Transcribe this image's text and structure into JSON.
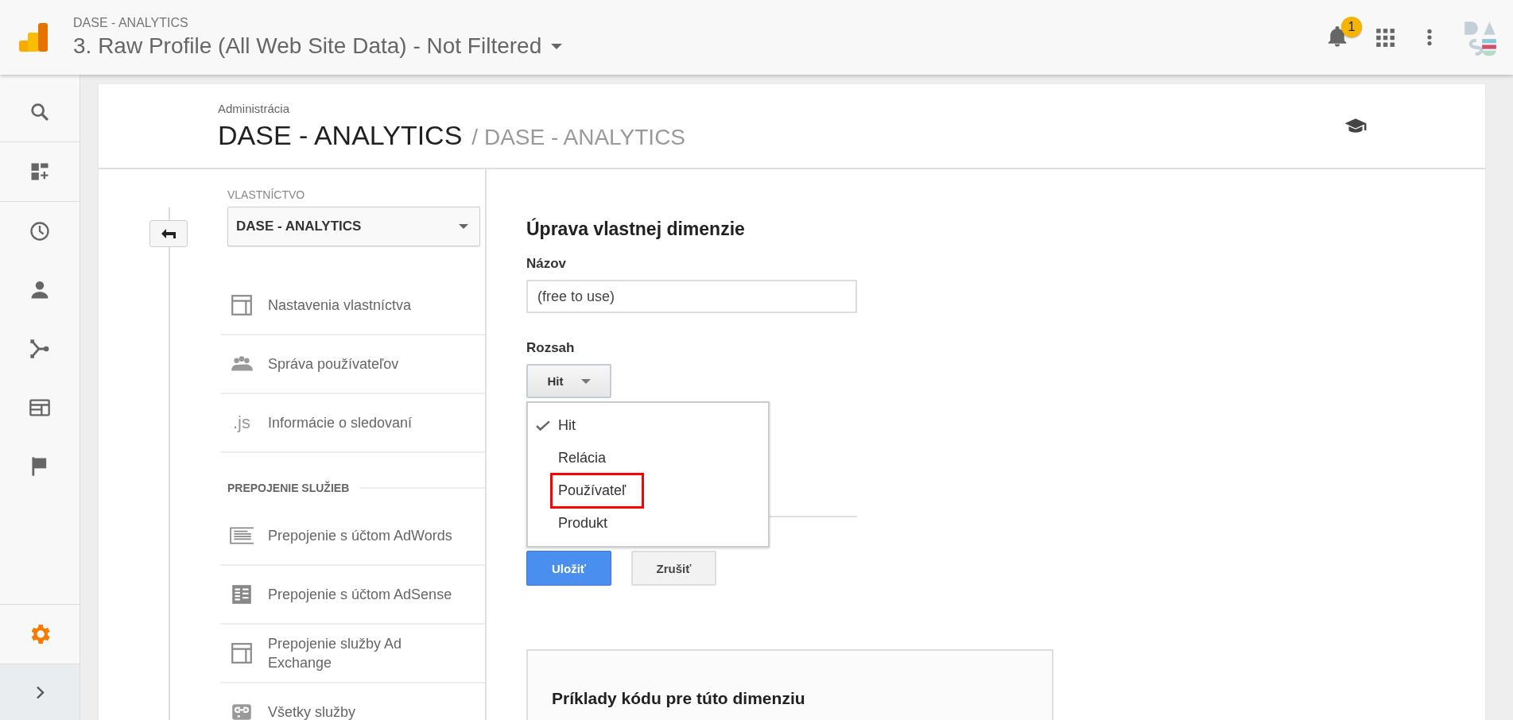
{
  "header": {
    "account": "DASE - ANALYTICS",
    "view": "3. Raw Profile (All Web Site Data) - Not Filtered",
    "notification_count": "1"
  },
  "rail": {
    "items": [
      {
        "kind": "search"
      },
      {
        "kind": "dashboard"
      },
      {
        "kind": "clock"
      },
      {
        "kind": "person"
      },
      {
        "kind": "fork"
      },
      {
        "kind": "window"
      },
      {
        "kind": "flag"
      }
    ],
    "admin": {
      "selected": true
    }
  },
  "breadcrumb": {
    "label": "Administrácia",
    "account": "DASE - ANALYTICS",
    "separator": "/",
    "property": "DASE - ANALYTICS"
  },
  "property_panel": {
    "label": "VLASTNÍCTVO",
    "selector": "DASE - ANALYTICS",
    "items": [
      {
        "kind": "layout",
        "label": "Nastavenia vlastníctva"
      },
      {
        "kind": "people",
        "label": "Správa používateľov"
      },
      {
        "kind": "js",
        "icon_text": ".js",
        "label": "Informácie o sledovaní"
      }
    ],
    "section": "PREPOJENIE SLUŽIEB",
    "links": [
      {
        "kind": "adwords",
        "label": "Prepojenie s účtom AdWords"
      },
      {
        "kind": "adsense",
        "label": "Prepojenie s účtom AdSense"
      },
      {
        "kind": "layout",
        "label": "Prepojenie služby Ad Exchange"
      },
      {
        "kind": "link",
        "label": "Všetky služby"
      }
    ]
  },
  "form": {
    "title": "Úprava vlastnej dimenzie",
    "name_label": "Názov",
    "name_value": "(free to use)",
    "scope_label": "Rozsah",
    "scope_value": "Hit",
    "options": [
      {
        "label": "Hit",
        "selected": true,
        "highlighted": false
      },
      {
        "label": "Relácia",
        "selected": false,
        "highlighted": false
      },
      {
        "label": "Používateľ",
        "selected": false,
        "highlighted": true
      },
      {
        "label": "Produkt",
        "selected": false,
        "highlighted": false
      }
    ],
    "save": "Uložiť",
    "cancel": "Zrušiť"
  },
  "code_examples": {
    "title": "Príklady kódu pre túto dimenziu"
  }
}
